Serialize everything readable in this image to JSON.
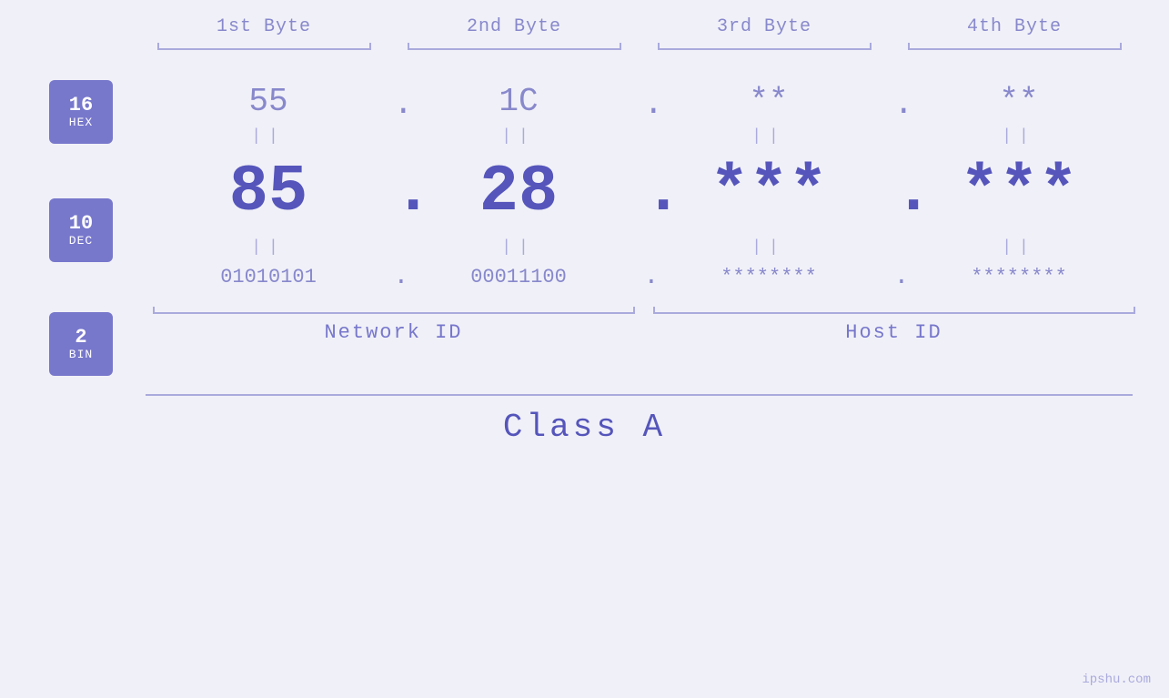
{
  "header": {
    "byte1": "1st Byte",
    "byte2": "2nd Byte",
    "byte3": "3rd Byte",
    "byte4": "4th Byte"
  },
  "badges": {
    "hex": {
      "number": "16",
      "label": "HEX"
    },
    "dec": {
      "number": "10",
      "label": "DEC"
    },
    "bin": {
      "number": "2",
      "label": "BIN"
    }
  },
  "hex_row": {
    "b1": "55",
    "b2": "1C",
    "b3": "**",
    "b4": "**",
    "sep": "."
  },
  "dec_row": {
    "b1": "85",
    "b2": "28",
    "b3": "***",
    "b4": "***",
    "sep": "."
  },
  "bin_row": {
    "b1": "01010101",
    "b2": "00011100",
    "b3": "********",
    "b4": "********",
    "sep": "."
  },
  "equals": "||",
  "ids": {
    "network": "Network ID",
    "host": "Host ID"
  },
  "class_label": "Class A",
  "watermark": "ipshu.com"
}
